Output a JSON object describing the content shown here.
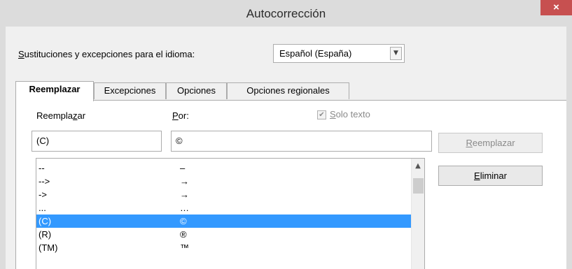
{
  "window": {
    "title": "Autocorrección",
    "close_icon": "×"
  },
  "language": {
    "label": "Sustituciones y excepciones para el idioma:",
    "label_hotkey": "S",
    "label_rest": "ustituciones y excepciones para el idioma:",
    "selected": "Español (España)"
  },
  "tabs": [
    {
      "label": "Reemplazar",
      "active": true
    },
    {
      "label": "Excepciones",
      "active": false
    },
    {
      "label": "Opciones",
      "active": false
    },
    {
      "label": "Opciones regionales",
      "active": false
    }
  ],
  "replace": {
    "label_pre": "Reempla",
    "label_hotkey": "z",
    "label_post": "ar",
    "value": "(C)"
  },
  "with": {
    "label_hotkey": "P",
    "label_post": "or:",
    "value": "©"
  },
  "text_only": {
    "label_hotkey": "S",
    "label_post": "olo texto",
    "checked": true,
    "enabled": false
  },
  "buttons": {
    "replace": {
      "hotkey": "R",
      "rest": "eemplazar",
      "enabled": false
    },
    "delete": {
      "hotkey": "E",
      "rest": "liminar",
      "enabled": true
    }
  },
  "list": {
    "rows": [
      {
        "from": "--",
        "to": "–",
        "selected": false
      },
      {
        "from": "-->",
        "to": "→",
        "selected": false
      },
      {
        "from": "->",
        "to": "→",
        "selected": false
      },
      {
        "from": "...",
        "to": "…",
        "selected": false
      },
      {
        "from": "(C)",
        "to": "©",
        "selected": true
      },
      {
        "from": "(R)",
        "to": "®",
        "selected": false
      },
      {
        "from": "(TM)",
        "to": "™",
        "selected": false
      }
    ]
  },
  "colors": {
    "selection": "#3399ff",
    "close": "#c75050"
  }
}
